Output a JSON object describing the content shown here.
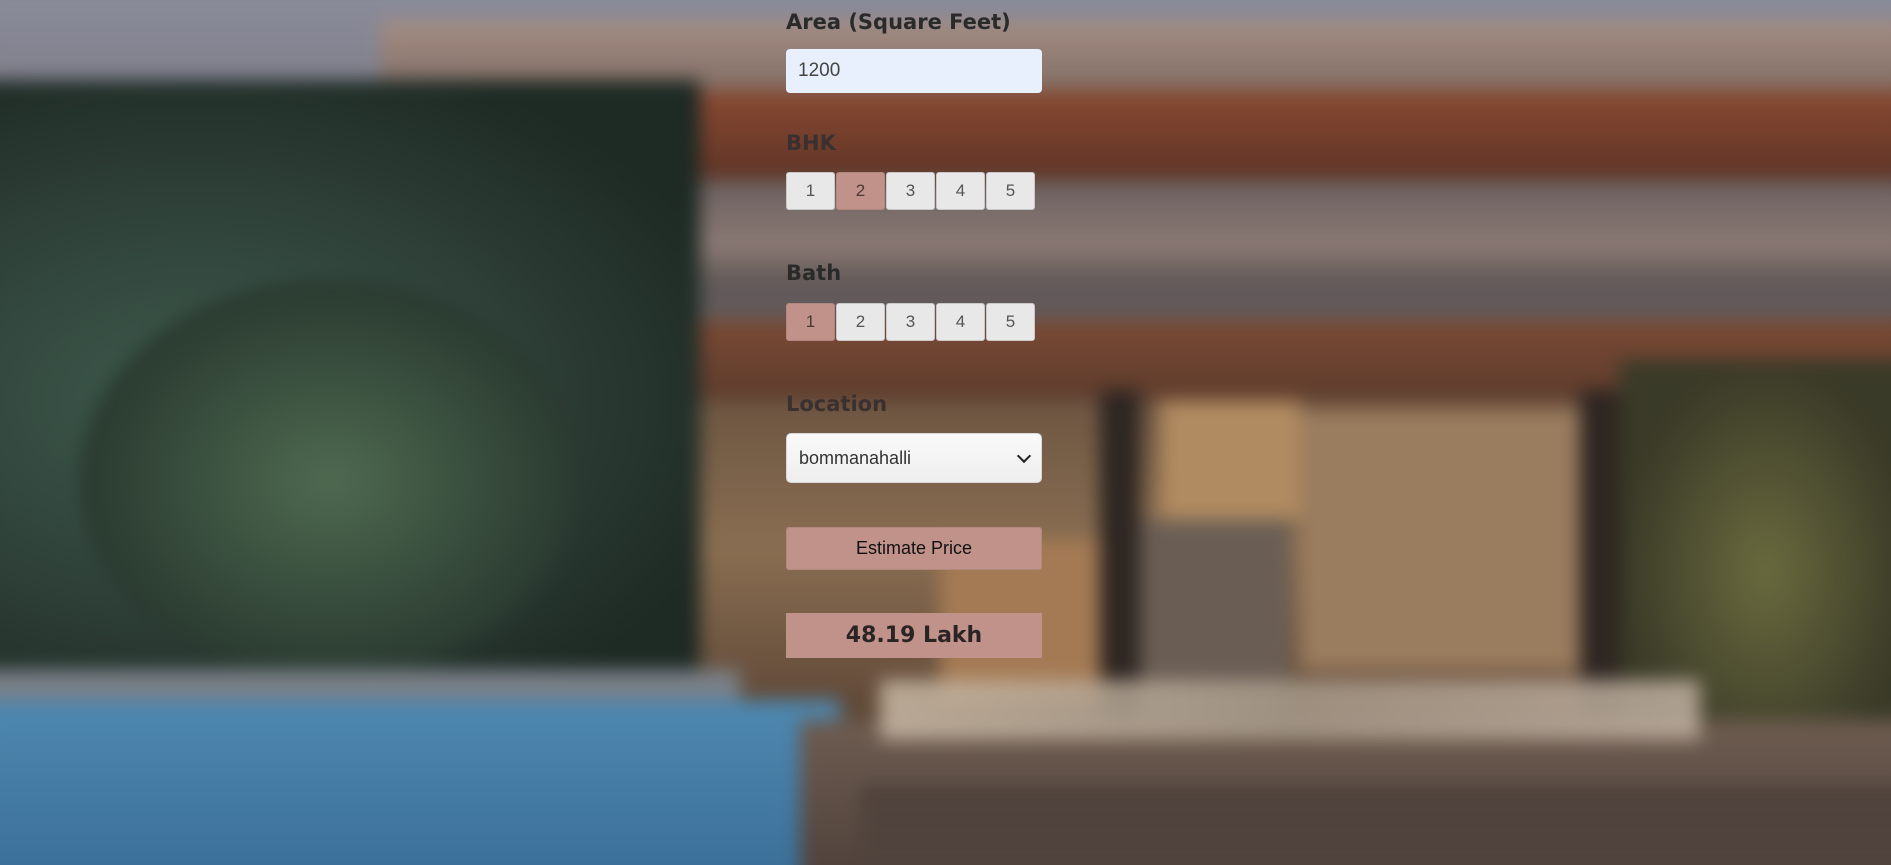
{
  "form": {
    "area_label": "Area (Square Feet)",
    "area_value": "1200",
    "bhk_label": "BHK",
    "bhk_options": [
      "1",
      "2",
      "3",
      "4",
      "5"
    ],
    "bhk_selected": "2",
    "bath_label": "Bath",
    "bath_options": [
      "1",
      "2",
      "3",
      "4",
      "5"
    ],
    "bath_selected": "1",
    "location_label": "Location",
    "location_selected": "bommanahalli",
    "estimate_label": "Estimate Price",
    "result_text": "48.19 Lakh"
  },
  "colors": {
    "accent": "#c0928a",
    "input_bg": "#e8f0fe"
  },
  "icons": {
    "dropdown": "chevron-down-icon"
  }
}
